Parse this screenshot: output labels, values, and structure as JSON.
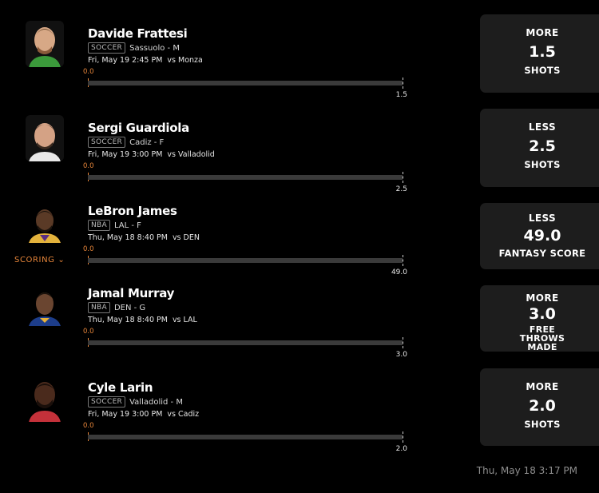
{
  "picks": [
    {
      "player": "Davide Frattesi",
      "league": "SOCCER",
      "team_pos": "Sassuolo - M",
      "date": "Fri, May 19 2:45 PM",
      "opponent": "vs Monza",
      "bar_start": "0.0",
      "bar_end": "1.5",
      "direction": "MORE",
      "line": "1.5",
      "stat": "SHOTS"
    },
    {
      "player": "Sergi Guardiola",
      "league": "SOCCER",
      "team_pos": "Cadiz - F",
      "date": "Fri, May 19 3:00 PM",
      "opponent": "vs Valladolid",
      "bar_start": "0.0",
      "bar_end": "2.5",
      "direction": "LESS",
      "line": "2.5",
      "stat": "SHOTS"
    },
    {
      "player": "LeBron James",
      "league": "NBA",
      "team_pos": "LAL - F",
      "date": "Thu, May 18 8:40 PM",
      "opponent": "vs DEN",
      "bar_start": "0.0",
      "bar_end": "49.0",
      "direction": "LESS",
      "line": "49.0",
      "stat": "FANTASY SCORE",
      "toggle_label": "SCORING"
    },
    {
      "player": "Jamal Murray",
      "league": "NBA",
      "team_pos": "DEN - G",
      "date": "Thu, May 18 8:40 PM",
      "opponent": "vs LAL",
      "bar_start": "0.0",
      "bar_end": "3.0",
      "direction": "MORE",
      "line": "3.0",
      "stat": "FREE THROWS MADE"
    },
    {
      "player": "Cyle Larin",
      "league": "SOCCER",
      "team_pos": "Valladolid - M",
      "date": "Fri, May 19 3:00 PM",
      "opponent": "vs Cadiz",
      "bar_start": "0.0",
      "bar_end": "2.0",
      "direction": "MORE",
      "line": "2.0",
      "stat": "SHOTS"
    }
  ],
  "footer_timestamp": "Thu, May 18 3:17 PM",
  "colors": {
    "accent": "#e8863a",
    "card_bg": "#1d1d1d",
    "bar_bg": "#3a3a3a"
  }
}
